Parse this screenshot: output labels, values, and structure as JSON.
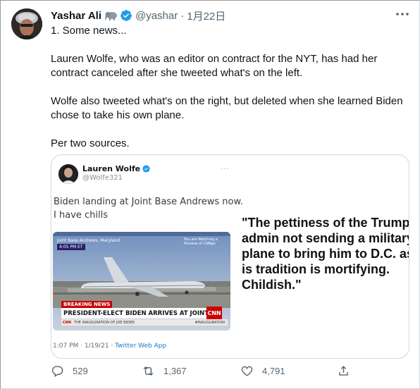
{
  "author": {
    "name": "Yashar Ali",
    "handle": "@yashar",
    "separator": "·",
    "date": "1月22日",
    "emoji_icon": "elephant-icon",
    "verified_icon": "verified-badge-icon"
  },
  "tweet": {
    "paragraphs": [
      "1. Some news...",
      "Lauren Wolfe, who was an editor on contract for the NYT, has had her contract canceled after she tweeted what's on the left.",
      "Wolfe also tweeted what's on the right, but deleted when she learned Biden chose to take his own plane.",
      "Per two sources."
    ]
  },
  "quoted": {
    "name": "Lauren Wolfe",
    "handle": "@Wolfe321",
    "more": "···",
    "text_lines": [
      "Biden landing at Joint Base Andrews now.",
      "I have chills"
    ],
    "photo": {
      "location": "Joint Base Andrews, Maryland",
      "time": "4:05 PM ET",
      "side_note": "You are Watching a Preview of CNNgo",
      "breaking": "BREAKING NEWS",
      "headline": "PRESIDENT-ELECT BIDEN ARRIVES AT JOINT BASE ANDREWS",
      "network": "CNN",
      "ticker_left_logo": "CNN",
      "ticker_text": "THE INAUGURATION OF JOE BIDEN",
      "ticker_tag": "#INAUGURATION"
    },
    "meta_time": "1:07 PM · 1/19/21 · ",
    "meta_source": "Twitter Web App",
    "right_quote_lines": [
      "\"The pettiness of the Trump",
      "admin not sending a military",
      "plane to bring him to D.C. as",
      "is tradition is mortifying.",
      "Childish.\""
    ]
  },
  "actions": {
    "replies": "529",
    "retweets": "1,367",
    "likes": "4,791"
  },
  "colors": {
    "text": "#0f1419",
    "secondary": "#536471",
    "accent": "#1d9bf0",
    "border": "#cfd9de"
  }
}
